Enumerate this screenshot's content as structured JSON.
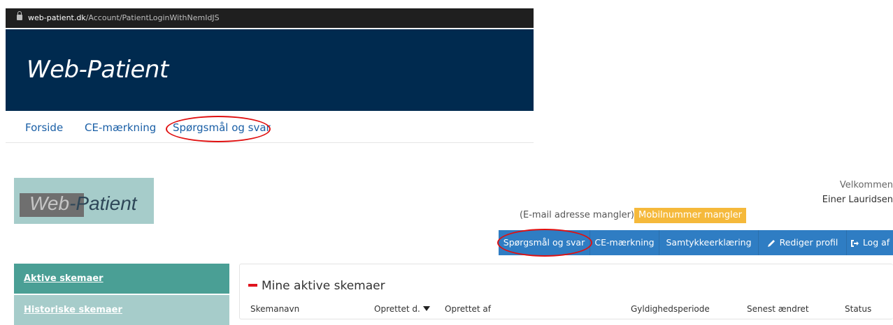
{
  "browser": {
    "url_host": "web-patient.dk",
    "url_path": "/Account/PatientLoginWithNemIdJS"
  },
  "hero": {
    "title": "Web-Patient"
  },
  "top_nav": {
    "items": [
      {
        "label": "Forside"
      },
      {
        "label": "CE-mærkning"
      },
      {
        "label": "Spørgsmål og svar"
      }
    ]
  },
  "logo": {
    "word1": "Web",
    "word2": "-Patient"
  },
  "user": {
    "welcome": "Velkommen",
    "name": "Einer Lauridsen",
    "email_missing": "(E-mail adresse mangler)",
    "mobile_missing": "Mobilnummer mangler"
  },
  "blue_nav": {
    "items": [
      {
        "label": "Spørgsmål og svar"
      },
      {
        "label": "CE-mærkning"
      },
      {
        "label": "Samtykkeerklæring"
      },
      {
        "label": "Rediger profil"
      },
      {
        "label": "Log af"
      }
    ]
  },
  "sidebar": {
    "items": [
      {
        "label": "Aktive skemaer"
      },
      {
        "label": "Historiske skemaer"
      }
    ]
  },
  "panel": {
    "title": "Mine aktive skemaer",
    "columns": [
      "Skemanavn",
      "Oprettet d.",
      "Oprettet af",
      "Gyldighedsperiode",
      "Senest ændret",
      "Status"
    ]
  },
  "colors": {
    "hero_bg": "#002a4f",
    "nav_blue": "#2f7dc3",
    "teal_active": "#4a9f95",
    "teal_light": "#a6ccca",
    "warning": "#f5b93b",
    "annotation_red": "#e01010"
  }
}
